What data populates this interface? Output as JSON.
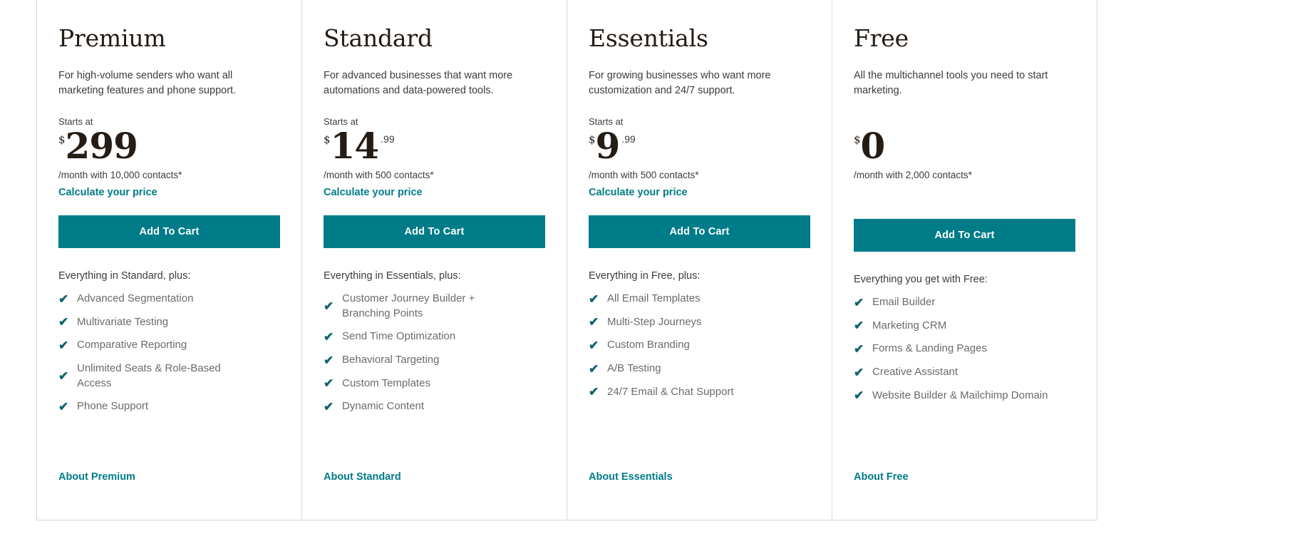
{
  "theme": {
    "teal": "#007c89",
    "check_teal": "#11646f",
    "text_dark": "#241c15",
    "text_body": "#3c3c3c",
    "text_feature": "#6b6b6b",
    "border": "#d8d8d8"
  },
  "icons": {
    "check": "check-icon",
    "check_glyph": "✔"
  },
  "plans": [
    {
      "name": "Premium",
      "description": "For high-volume senders who want all marketing features and phone support.",
      "starts_at_label": "Starts at",
      "currency": "$",
      "amount": "299",
      "cents": "",
      "contacts_note": "/month with 10,000 contacts*",
      "calculate_link": "Calculate your price",
      "cta_label": "Add To Cart",
      "features_heading": "Everything in Standard, plus:",
      "features": [
        "Advanced Segmentation",
        "Multivariate Testing",
        "Comparative Reporting",
        "Unlimited Seats & Role-Based Access",
        "Phone Support"
      ],
      "about_link": "About Premium"
    },
    {
      "name": "Standard",
      "description": "For advanced businesses that want more automations and data-powered tools.",
      "starts_at_label": "Starts at",
      "currency": "$",
      "amount": "14",
      "cents": ".99",
      "contacts_note": "/month with 500 contacts*",
      "calculate_link": "Calculate your price",
      "cta_label": "Add To Cart",
      "features_heading": "Everything in Essentials, plus:",
      "features": [
        "Customer Journey Builder + Branching Points",
        "Send Time Optimization",
        "Behavioral Targeting",
        "Custom Templates",
        "Dynamic Content"
      ],
      "about_link": "About Standard"
    },
    {
      "name": "Essentials",
      "description": "For growing businesses who want more customization and 24/7 support.",
      "starts_at_label": "Starts at",
      "currency": "$",
      "amount": "9",
      "cents": ".99",
      "contacts_note": "/month with 500 contacts*",
      "calculate_link": "Calculate your price",
      "cta_label": "Add To Cart",
      "features_heading": "Everything in Free, plus:",
      "features": [
        "All Email Templates",
        "Multi-Step Journeys",
        "Custom Branding",
        "A/B Testing",
        "24/7 Email & Chat Support"
      ],
      "about_link": "About Essentials"
    },
    {
      "name": "Free",
      "description": "All the multichannel tools you need to start marketing.",
      "starts_at_label": "",
      "currency": "$",
      "amount": "0",
      "cents": "",
      "contacts_note": "/month with 2,000 contacts*",
      "calculate_link": "",
      "cta_label": "Add To Cart",
      "features_heading": "Everything you get with Free:",
      "features": [
        "Email Builder",
        "Marketing CRM",
        "Forms & Landing Pages",
        "Creative Assistant",
        "Website Builder & Mailchimp Domain"
      ],
      "about_link": "About Free"
    }
  ]
}
